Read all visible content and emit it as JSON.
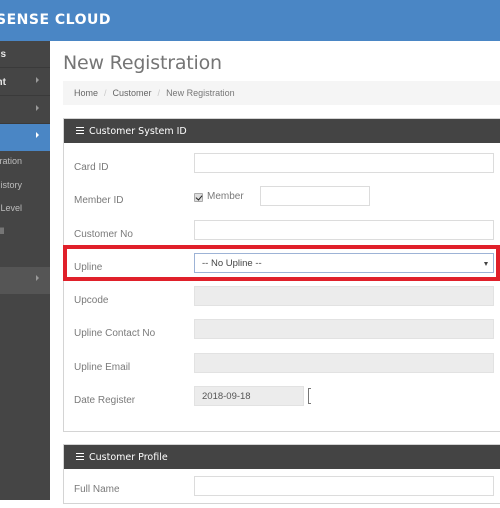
{
  "app": {
    "brand": "SENSE CLOUD"
  },
  "sidebar": {
    "items": [
      {
        "label": "s",
        "active": false
      },
      {
        "label": "nt",
        "active": false
      },
      {
        "label": "",
        "active": false
      },
      {
        "label": "",
        "active": true
      }
    ],
    "sub_items": [
      {
        "label": "stration"
      },
      {
        "label": "History"
      },
      {
        "label": "Level"
      },
      {
        "label": "ll"
      }
    ],
    "extra_item": {
      "label": ""
    }
  },
  "page": {
    "title": "New Registration"
  },
  "breadcrumb": {
    "items": [
      "Home",
      "Customer",
      "New Registration"
    ],
    "separator": "/"
  },
  "system_panel": {
    "title": "Customer System ID",
    "fields": {
      "card_id": {
        "label": "Card ID",
        "value": ""
      },
      "member_id": {
        "label": "Member ID",
        "checkbox_label": "Member",
        "checked": true,
        "value": ""
      },
      "customer_no": {
        "label": "Customer No",
        "value": ""
      },
      "upline": {
        "label": "Upline",
        "selected": "-- No Upline --"
      },
      "upcode": {
        "label": "Upcode",
        "value": ""
      },
      "upline_contact": {
        "label": "Upline Contact No",
        "value": ""
      },
      "upline_email": {
        "label": "Upline Email",
        "value": ""
      },
      "date_register": {
        "label": "Date Register",
        "value": "2018-09-18"
      }
    }
  },
  "profile_panel": {
    "title": "Customer Profile",
    "fields": {
      "full_name": {
        "label": "Full Name",
        "value": ""
      }
    }
  },
  "colors": {
    "brand": "#4a86c5",
    "sidebar": "#454545",
    "panel_header": "#444444",
    "highlight": "#e0202a"
  }
}
